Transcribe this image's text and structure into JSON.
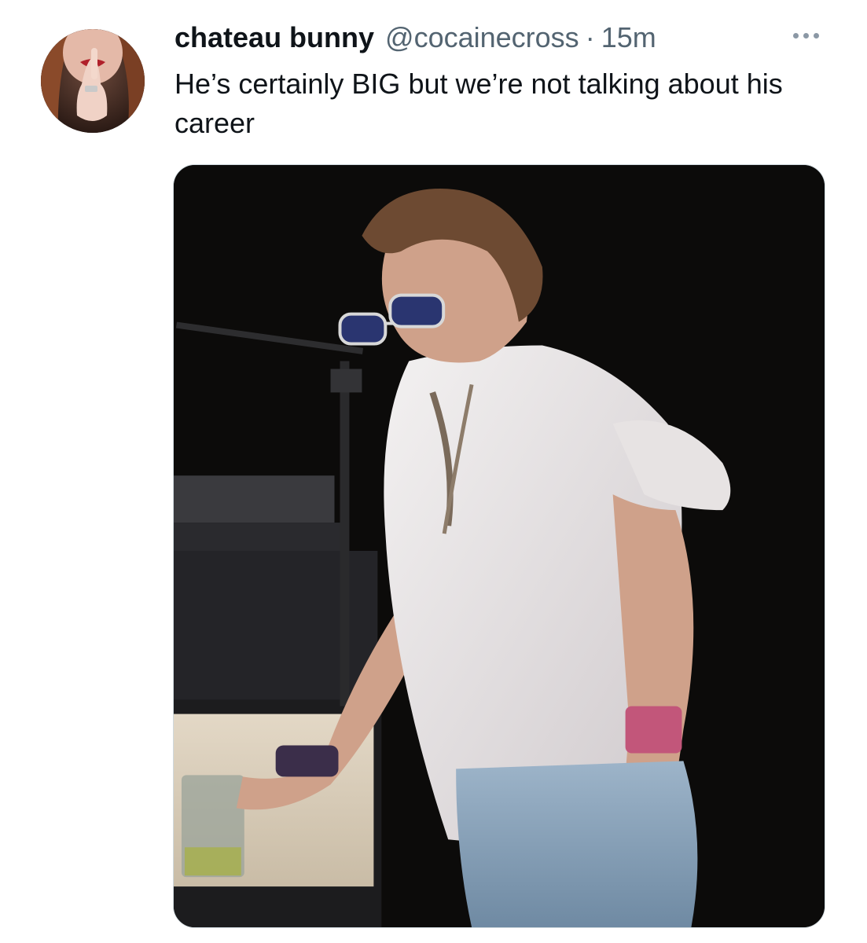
{
  "tweet": {
    "author": {
      "display_name": "chateau bunny",
      "handle": "@cocainecross"
    },
    "separator": "·",
    "timestamp": "15m",
    "text": "He’s certainly BIG but we’re not talking about his career",
    "more_icon": "more-horizontal-icon",
    "media": {
      "kind": "photo"
    }
  },
  "colors": {
    "primary_text": "#0f1419",
    "secondary_text": "#536471",
    "background": "#ffffff"
  }
}
